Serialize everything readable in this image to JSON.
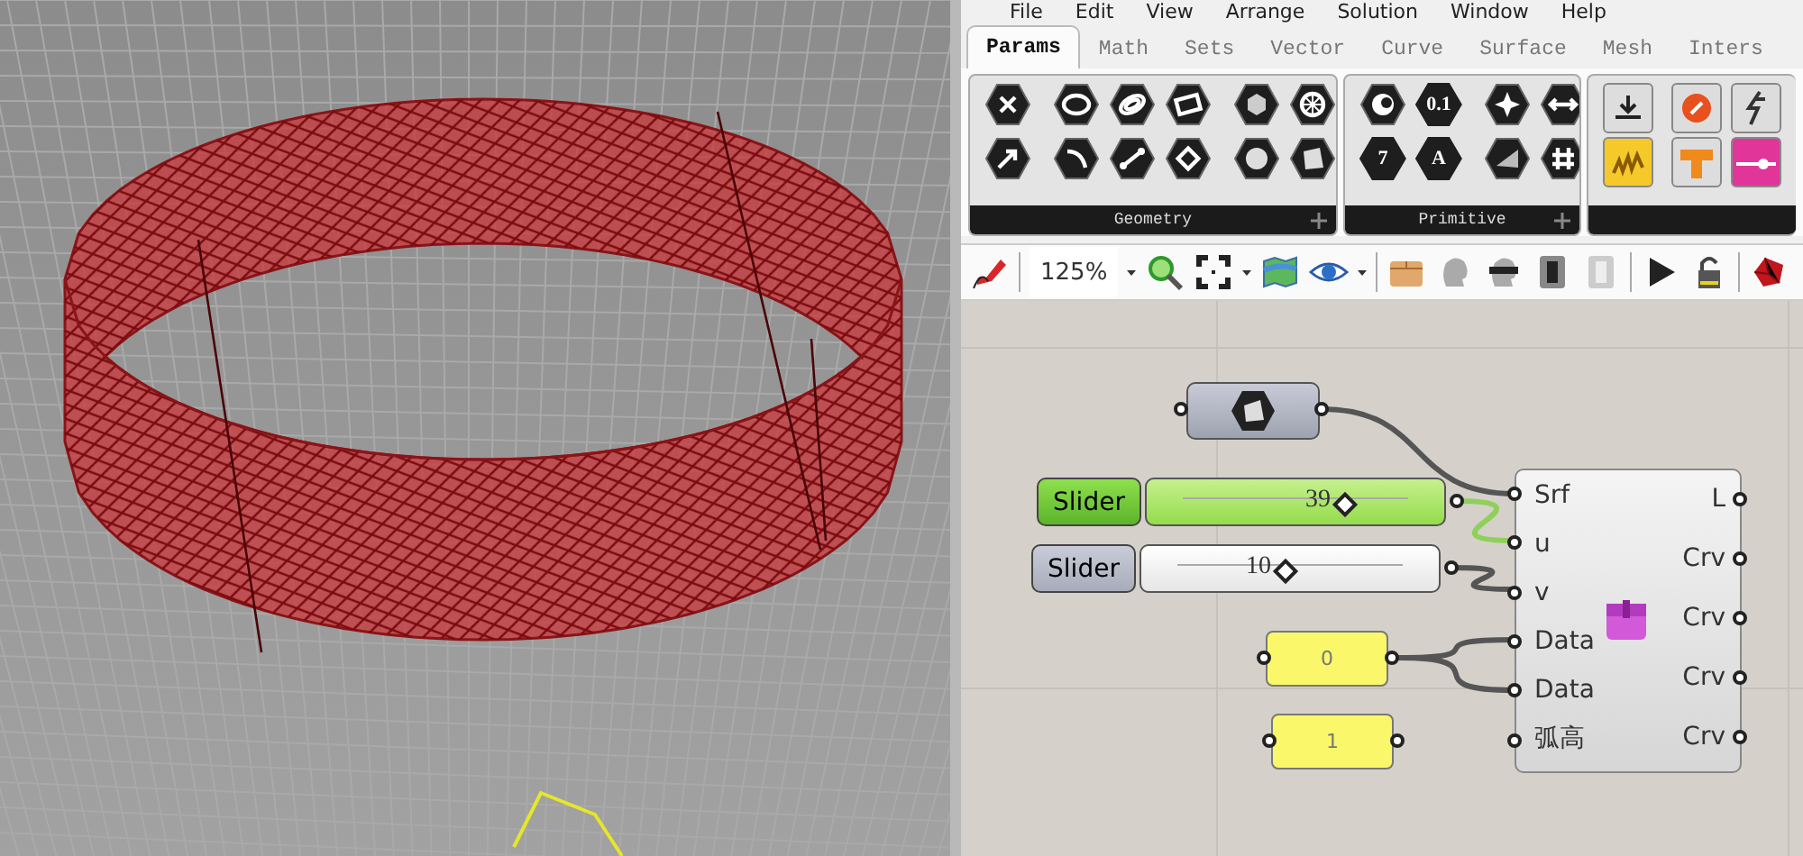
{
  "menu": [
    "File",
    "Edit",
    "View",
    "Arrange",
    "Solution",
    "Window",
    "Help"
  ],
  "tabs": [
    {
      "label": "Params",
      "selected": true
    },
    {
      "label": "Math",
      "selected": false
    },
    {
      "label": "Sets",
      "selected": false
    },
    {
      "label": "Vector",
      "selected": false
    },
    {
      "label": "Curve",
      "selected": false
    },
    {
      "label": "Surface",
      "selected": false
    },
    {
      "label": "Mesh",
      "selected": false
    },
    {
      "label": "Inters",
      "selected": false
    }
  ],
  "ribbon": {
    "groups": [
      {
        "title": "Geometry"
      },
      {
        "title": "Primitive",
        "glyphs": [
          "0.1",
          "7",
          "A"
        ]
      }
    ]
  },
  "toolbar": {
    "zoom": "125%"
  },
  "canvas": {
    "sliders": [
      {
        "label": "Slider",
        "value": "39",
        "level": 0.72,
        "selected": true
      },
      {
        "label": "Slider",
        "value": "10",
        "level": 0.48,
        "selected": false
      }
    ],
    "panels": [
      {
        "text": "0"
      },
      {
        "text": "1"
      }
    ],
    "component": {
      "inputs": [
        "Srf",
        "u",
        "v",
        "Data",
        "Data",
        "弧高"
      ],
      "outputs": [
        "L",
        "Crv",
        "Crv",
        "Crv",
        "Crv"
      ]
    }
  }
}
